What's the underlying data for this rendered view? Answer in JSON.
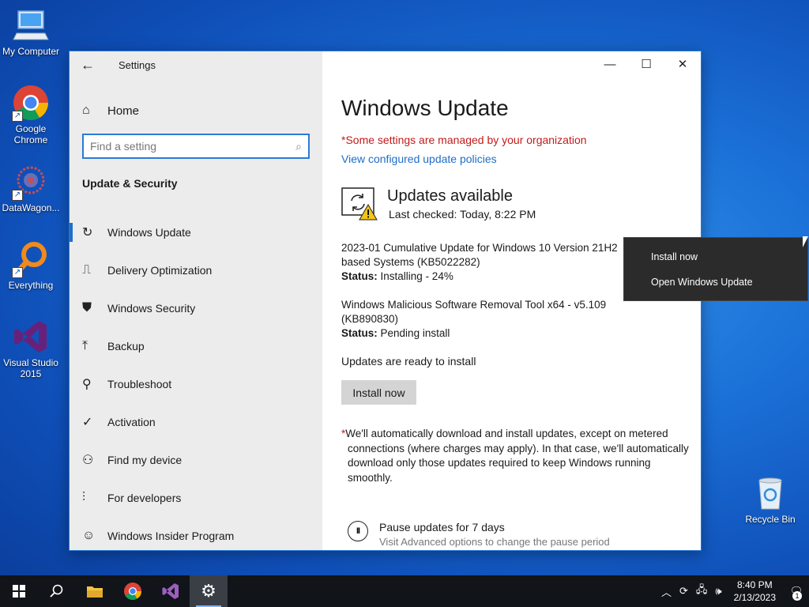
{
  "desktop": {
    "icons": [
      {
        "label": "My Computer",
        "icon": "computer-icon"
      },
      {
        "label": "Google Chrome",
        "icon": "chrome-icon"
      },
      {
        "label": "DataWagon...",
        "icon": "datawagon-icon"
      },
      {
        "label": "Everything",
        "icon": "everything-icon"
      },
      {
        "label": "Visual Studio 2015",
        "icon": "visual-studio-icon"
      },
      {
        "label": "Recycle Bin",
        "icon": "recycle-bin-icon"
      }
    ]
  },
  "window": {
    "title": "Settings",
    "controls": {
      "minimize": "—",
      "maximize": "☐",
      "close": "✕"
    }
  },
  "sidebar": {
    "home_label": "Home",
    "search_placeholder": "Find a setting",
    "section_title": "Update & Security",
    "items": [
      {
        "label": "Windows Update",
        "icon": "sync-icon",
        "active": true
      },
      {
        "label": "Delivery Optimization",
        "icon": "delivery-icon"
      },
      {
        "label": "Windows Security",
        "icon": "shield-icon"
      },
      {
        "label": "Backup",
        "icon": "backup-icon"
      },
      {
        "label": "Troubleshoot",
        "icon": "wrench-icon"
      },
      {
        "label": "Activation",
        "icon": "check-circle-icon"
      },
      {
        "label": "Find my device",
        "icon": "person-icon"
      },
      {
        "label": "For developers",
        "icon": "sliders-icon"
      },
      {
        "label": "Windows Insider Program",
        "icon": "cat-icon"
      }
    ]
  },
  "main": {
    "title": "Windows Update",
    "managed_notice": "*Some settings are managed by your organization",
    "policies_link": "View configured update policies",
    "status_heading": "Updates available",
    "last_checked": "Last checked: Today, 8:22 PM",
    "updates": [
      {
        "name": "2023-01 Cumulative Update for Windows 10 Version 21H2",
        "name_line2": "based Systems (KB5022282)",
        "status_label": "Status:",
        "status_value": "Installing - 24%"
      },
      {
        "name": "Windows Malicious Software Removal Tool x64 - v5.109",
        "name_line2": "(KB890830)",
        "status_label": "Status:",
        "status_value": "Pending install"
      }
    ],
    "ready_text": "Updates are ready to install",
    "install_button": "Install now",
    "note_star": "*",
    "note_text": "We'll automatically download and install updates, except on metered connections (where charges may apply). In that case, we'll automatically download only those updates required to keep Windows running smoothly.",
    "pause_title": "Pause updates for 7 days",
    "pause_sub": "Visit Advanced options to change the pause period"
  },
  "context_menu": {
    "items": [
      "Install now",
      "Open Windows Update"
    ]
  },
  "taskbar": {
    "apps": [
      "start-icon",
      "search-icon",
      "file-explorer-icon",
      "chrome-icon",
      "visual-studio-icon",
      "settings-icon"
    ],
    "clock_time": "8:40 PM",
    "clock_date": "2/13/2023",
    "notification_count": "1"
  }
}
